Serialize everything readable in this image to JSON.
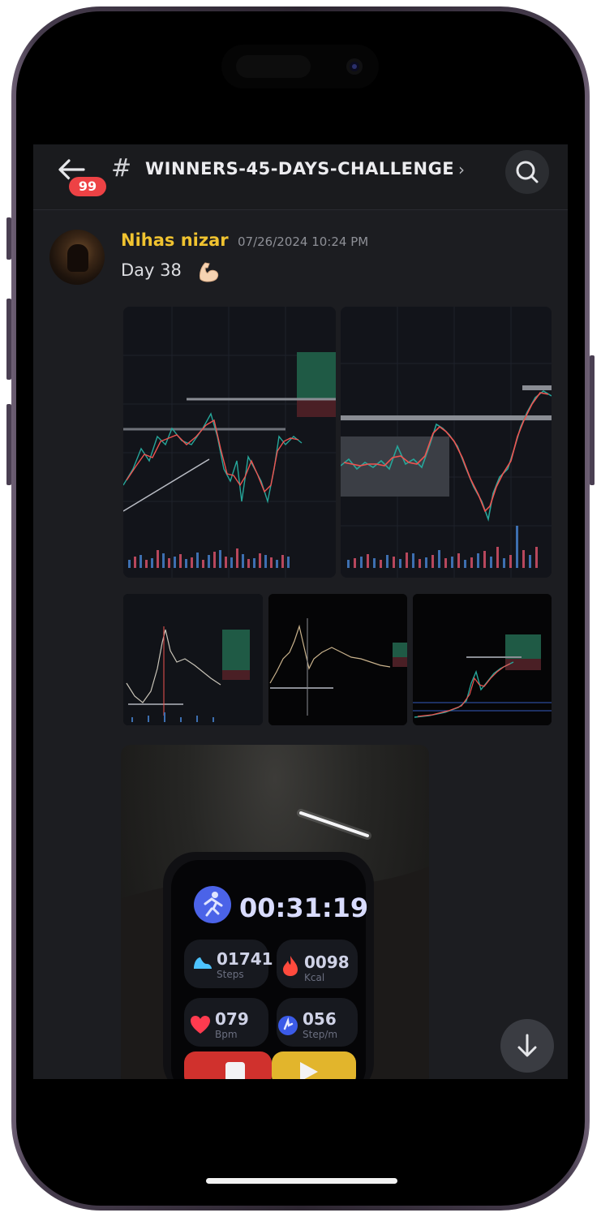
{
  "header": {
    "badge_count": "99",
    "hash_symbol": "#",
    "channel_name": "WINNERS-45-DAYS-CHALLENGE",
    "chevron": "›",
    "back_icon": "arrow-left-icon",
    "search_icon": "search-icon"
  },
  "message": {
    "author": "Nihas nizar",
    "timestamp": "07/26/2024 10:24 PM",
    "text": "Day  38",
    "emoji": "flexed-biceps-emoji"
  },
  "video": {
    "timer": "00:31:19",
    "steps_value": "01741",
    "steps_label": "Steps",
    "kcal_value": "0098",
    "kcal_label": "Kcal",
    "bpm_value": "079",
    "bpm_label": "Bpm",
    "cadence_value": "056",
    "cadence_label": "Step/m"
  },
  "colors": {
    "accent_username": "#f0c330",
    "badge": "#ed4245",
    "bull_candle": "#26a69a",
    "bear_candle": "#ef5350"
  },
  "scroll_button_icon": "arrow-down-icon"
}
